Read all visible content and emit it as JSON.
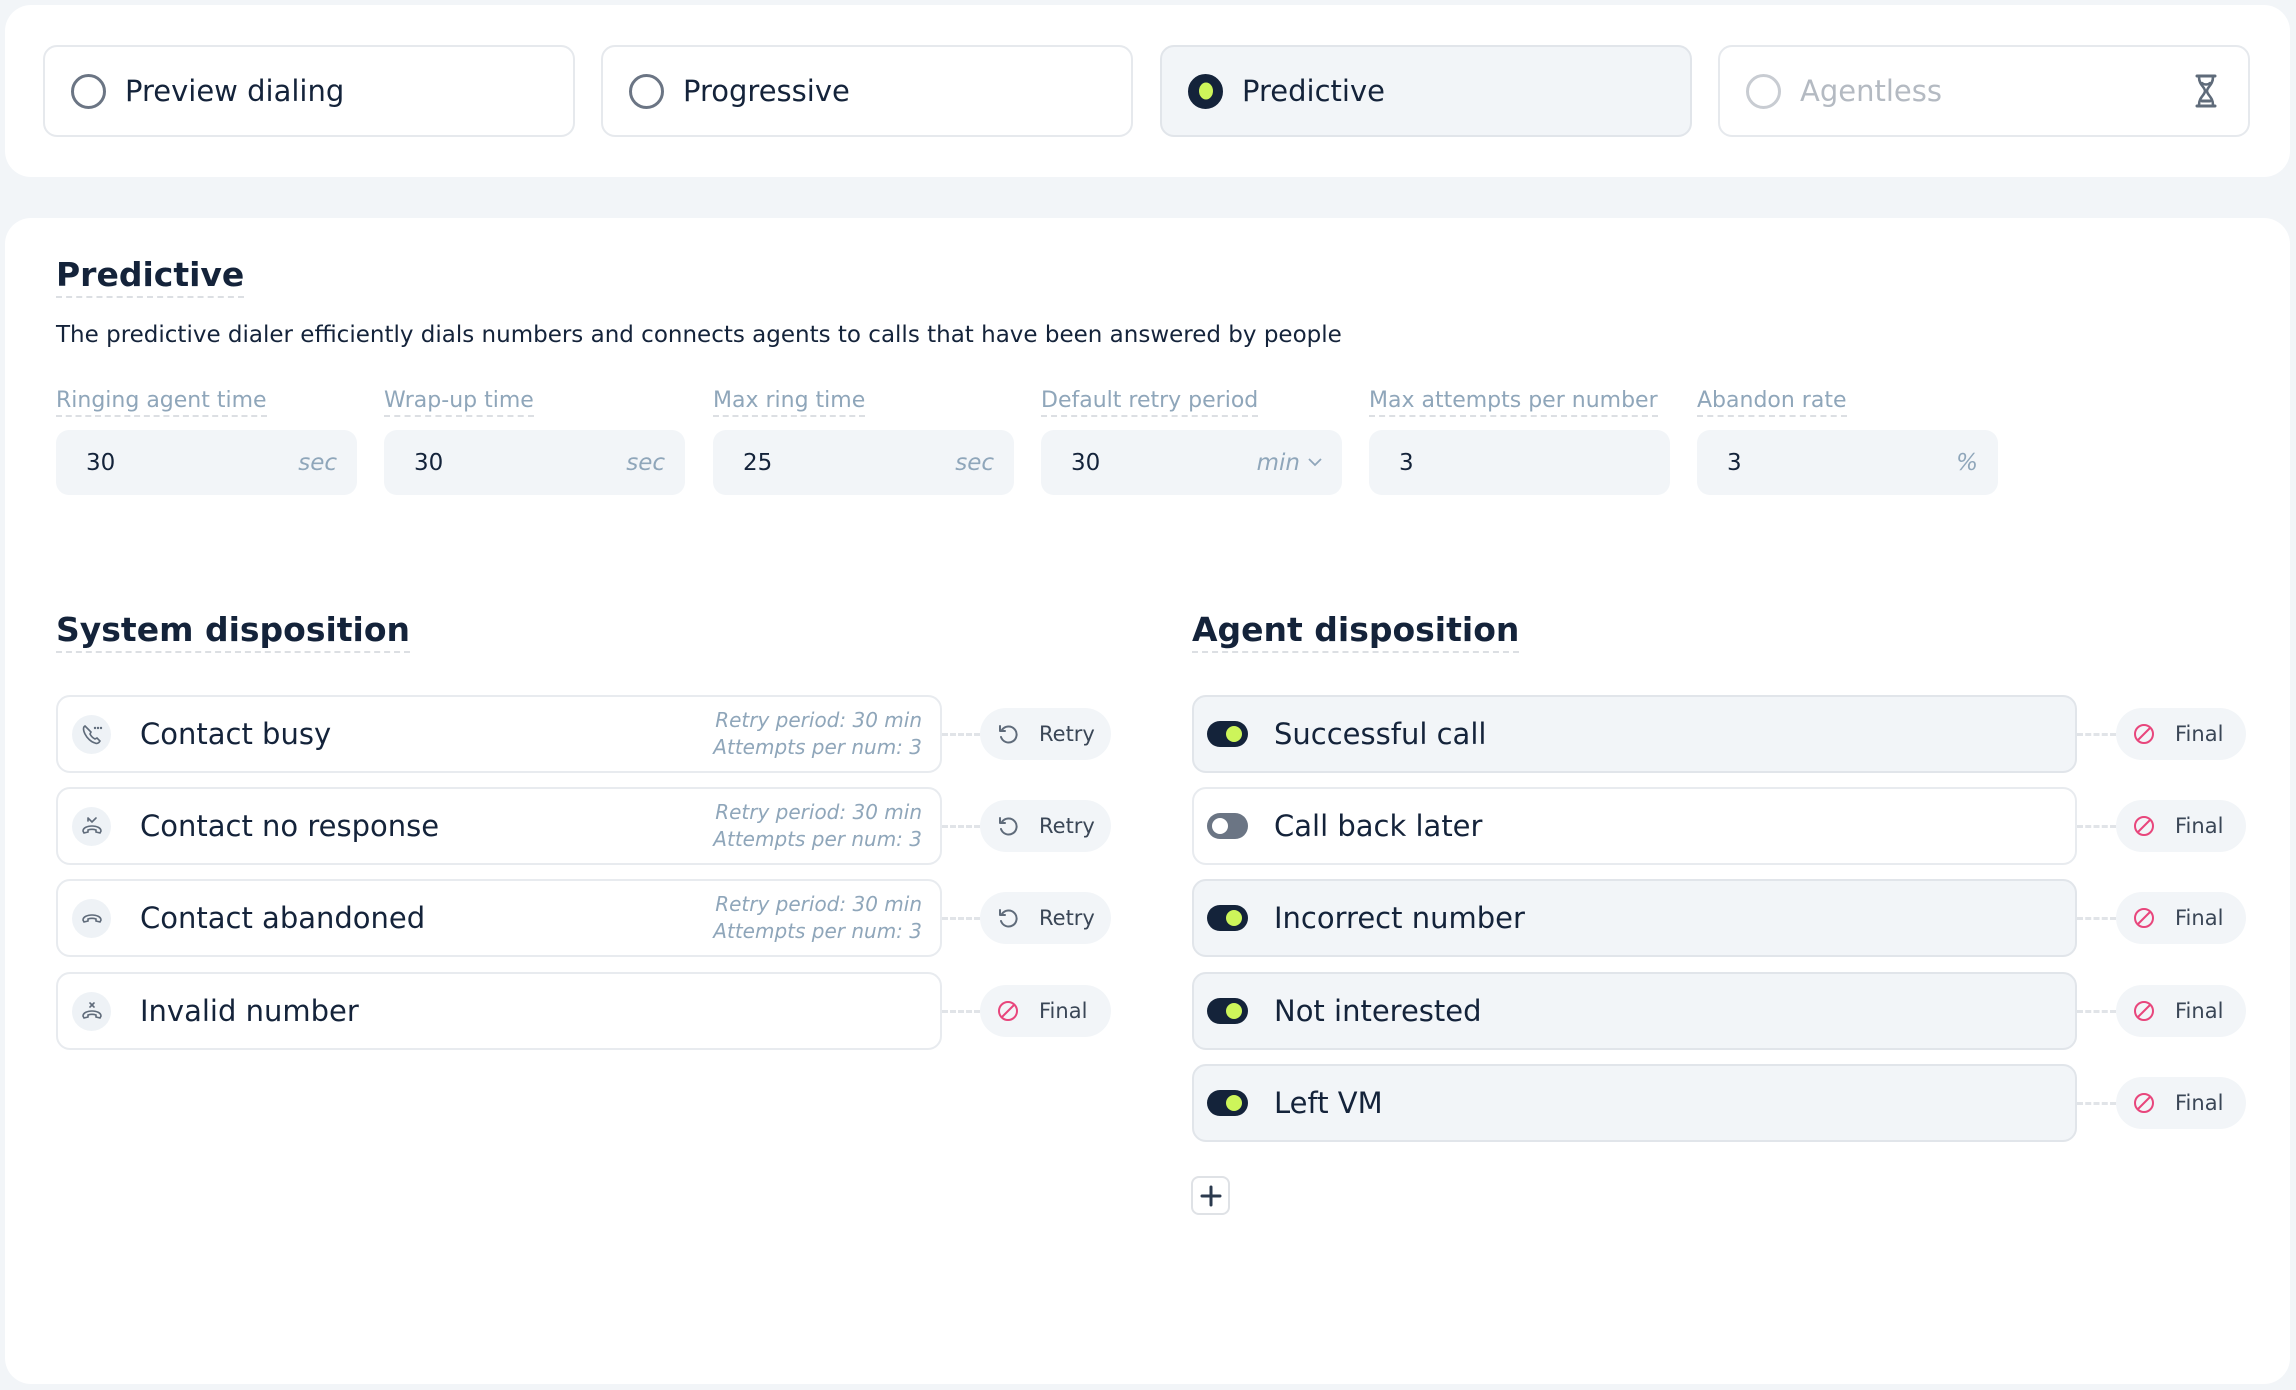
{
  "modes": [
    {
      "label": "Preview dialing",
      "state": "unselected"
    },
    {
      "label": "Progressive",
      "state": "unselected"
    },
    {
      "label": "Predictive",
      "state": "selected"
    },
    {
      "label": "Agentless",
      "state": "disabled",
      "icon": "hourglass-icon"
    }
  ],
  "predictive": {
    "title": "Predictive",
    "description": "The predictive dialer efficiently dials numbers and connects agents to calls that have been answered by people",
    "fields": [
      {
        "label": "Ringing agent time",
        "value": "30",
        "unit": "sec"
      },
      {
        "label": "Wrap-up time",
        "value": "30",
        "unit": "sec"
      },
      {
        "label": "Max ring time",
        "value": "25",
        "unit": "sec"
      },
      {
        "label": "Default retry period",
        "value": "30",
        "unit": "min",
        "dropdown": true
      },
      {
        "label": "Max attempts per number",
        "value": "3",
        "unit": ""
      },
      {
        "label": "Abandon rate",
        "value": "3",
        "unit": "%"
      }
    ]
  },
  "system_disposition": {
    "title": "System disposition",
    "items": [
      {
        "label": "Contact busy",
        "icon": "phone-busy-icon",
        "retry_period": "Retry period: 30 min",
        "attempts": "Attempts per num: 3",
        "action": "Retry"
      },
      {
        "label": "Contact no response",
        "icon": "phone-missed-icon",
        "retry_period": "Retry period: 30 min",
        "attempts": "Attempts per num: 3",
        "action": "Retry"
      },
      {
        "label": "Contact abandoned",
        "icon": "phone-hangup-icon",
        "retry_period": "Retry period: 30 min",
        "attempts": "Attempts per num: 3",
        "action": "Retry"
      },
      {
        "label": "Invalid number",
        "icon": "phone-invalid-icon",
        "retry_period": "",
        "attempts": "",
        "action": "Final"
      }
    ]
  },
  "agent_disposition": {
    "title": "Agent disposition",
    "items": [
      {
        "label": "Successful call",
        "enabled": true,
        "action": "Final"
      },
      {
        "label": "Call back later",
        "enabled": false,
        "action": "Final"
      },
      {
        "label": "Incorrect number",
        "enabled": true,
        "action": "Final"
      },
      {
        "label": "Not interested",
        "enabled": true,
        "action": "Final"
      },
      {
        "label": "Left VM",
        "enabled": true,
        "action": "Final"
      }
    ],
    "add_label": "+"
  },
  "colors": {
    "accent": "#cdf55a",
    "dark": "#14233a",
    "final_icon": "#e8467c",
    "background": "#f2f5f8"
  }
}
